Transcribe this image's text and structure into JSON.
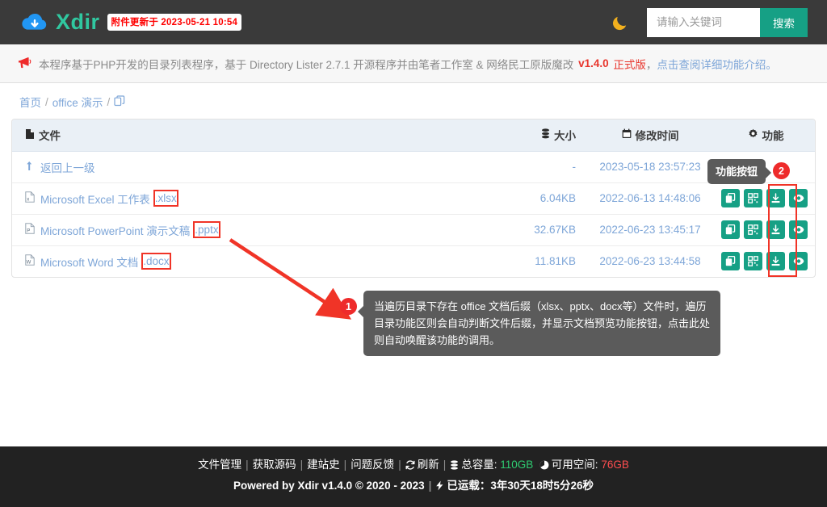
{
  "header": {
    "brand": "Xdir",
    "logo_icon": "cloud-download-icon",
    "update_badge": "附件更新于 2023-05-21 10:54",
    "theme_toggle_icon": "moon-icon",
    "search": {
      "placeholder": "请输入关键词",
      "value": "",
      "button_label": "搜索"
    }
  },
  "notice": {
    "icon": "megaphone-icon",
    "text_1": "本程序基于PHP开发的目录列表程序，基于 Directory Lister 2.7.1 开源程序并由笔者工作室 & 网络民工原版魔改",
    "version": "v1.4.0",
    "release": "正式版",
    "comma": "，",
    "link": "点击查阅详细功能介绍。"
  },
  "breadcrumb": {
    "home": "首页",
    "sep": "/",
    "current": "office 演示",
    "copy_icon": "copy-path-icon"
  },
  "table": {
    "columns": {
      "name": "文件",
      "size": "大小",
      "time": "修改时间",
      "action": "功能"
    },
    "column_icons": {
      "name": "file-icon",
      "size": "database-icon",
      "time": "calendar-icon",
      "action": "gear-icon"
    },
    "parent_row": {
      "label": "返回上一级",
      "icon": "level-up-icon",
      "size": "-",
      "time": "2023-05-18 23:57:23"
    },
    "rows": [
      {
        "icon": "excel-file-icon",
        "name_base": "Microsoft Excel 工作表",
        "name_ext": ".xlsx",
        "size": "6.04KB",
        "time": "2022-06-13 14:48:06",
        "highlight_ext": true
      },
      {
        "icon": "powerpoint-file-icon",
        "name_base": "Microsoft PowerPoint 演示文稿",
        "name_ext": ".pptx",
        "size": "32.67KB",
        "time": "2022-06-23 13:45:17",
        "highlight_ext": true
      },
      {
        "icon": "word-file-icon",
        "name_base": "Microsoft Word 文档",
        "name_ext": ".docx",
        "size": "11.81KB",
        "time": "2022-06-23 13:44:58",
        "highlight_ext": true
      }
    ],
    "action_buttons": [
      {
        "icon": "copy-link-icon",
        "name": "copy-link-button"
      },
      {
        "icon": "qrcode-icon",
        "name": "qrcode-button"
      },
      {
        "icon": "download-icon",
        "name": "download-button"
      },
      {
        "icon": "eye-preview-icon",
        "name": "preview-button"
      }
    ],
    "info_icon": "info-circle-icon"
  },
  "callouts": {
    "badge_1": "1",
    "badge_2": "2",
    "tip_function_buttons": "功能按钮",
    "tip_main": "当遍历目录下存在 office 文档后缀（xlsx、pptx、docx等）文件时，遍历目录功能区则会自动判断文件后缀，并显示文档预览功能按钮，点击此处则自动唤醒该功能的调用。"
  },
  "footer": {
    "links": [
      "文件管理",
      "获取源码",
      "建站史",
      "问题反馈"
    ],
    "refresh_icon": "refresh-icon",
    "refresh_label": "刷新",
    "capacity_icon": "database-icon",
    "capacity_label": "总容量:",
    "capacity_value": "110GB",
    "free_icon": "pie-chart-icon",
    "free_label": "可用空间:",
    "free_value": "76GB",
    "powered": "Powered by Xdir v1.4.0  © 2020 - 2023",
    "uptime_icon": "bolt-icon",
    "uptime_label": "已运载：",
    "uptime_value": "3年30天18时5分26秒",
    "separator": "|"
  },
  "colors": {
    "brand_green": "#30c8a0",
    "accent_teal": "#16a085",
    "header_bg": "#3a3a3a",
    "footer_bg": "#222222",
    "link_blue": "#7ea6d8",
    "highlight_red": "#f03427",
    "badge_red": "#ee2b2b"
  }
}
